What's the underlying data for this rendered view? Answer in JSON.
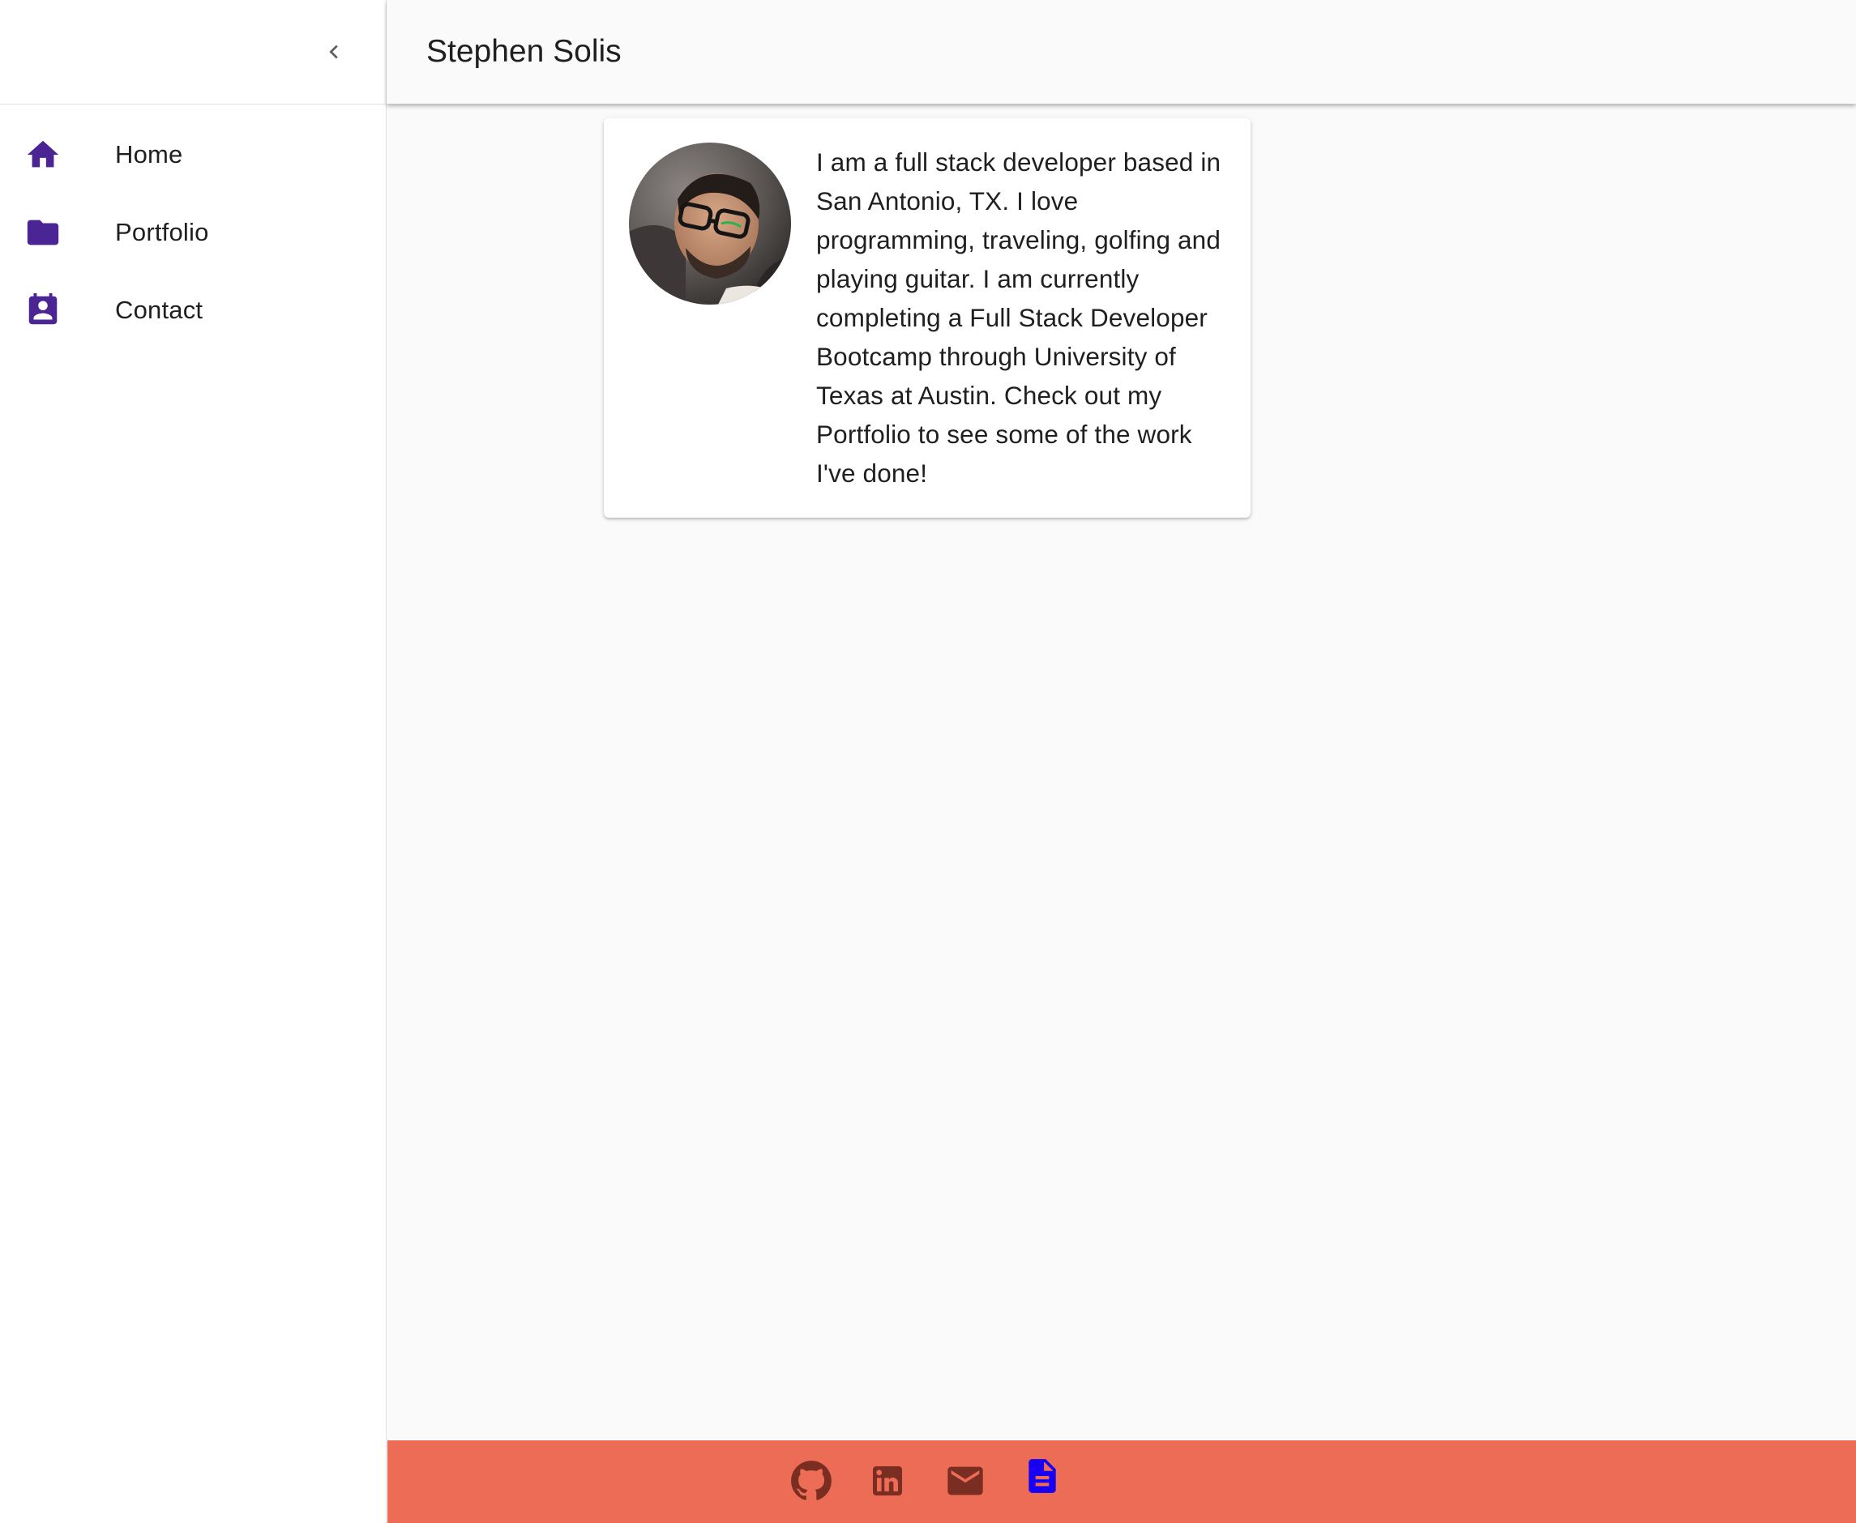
{
  "appbar": {
    "title": "Stephen Solis"
  },
  "drawer": {
    "collapse_icon": "chevron-left-icon",
    "items": [
      {
        "label": "Home",
        "icon": "home-icon"
      },
      {
        "label": "Portfolio",
        "icon": "folder-icon"
      },
      {
        "label": "Contact",
        "icon": "contact-calendar-icon"
      }
    ]
  },
  "about": {
    "photo": "profile-photo",
    "bio": "I am a full stack developer based in San Antonio, TX. I love programming, traveling, golfing and playing guitar. I am currently completing a Full Stack Developer Bootcamp through University of Texas at Austin. Check out my Portfolio to see some of the work I've done!"
  },
  "footer": {
    "links": [
      {
        "icon": "github-icon"
      },
      {
        "icon": "linkedin-icon"
      },
      {
        "icon": "mail-icon"
      },
      {
        "icon": "resume-document-icon"
      }
    ]
  },
  "colors": {
    "accent_purple": "#4a2593",
    "footer_bg": "#ec6c55",
    "footer_icon": "#7a2d21",
    "resume_icon": "#1800f5"
  }
}
